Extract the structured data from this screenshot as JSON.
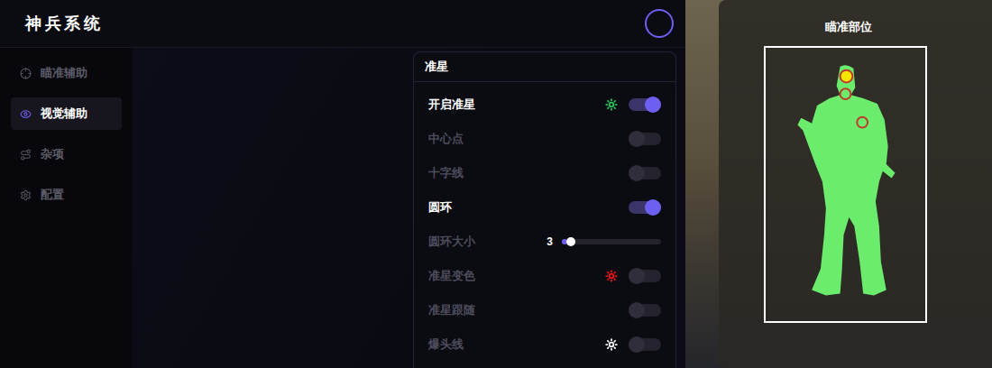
{
  "app": {
    "title": "神兵系统"
  },
  "sidebar": {
    "items": [
      {
        "label": "瞄准辅助",
        "selected": false
      },
      {
        "label": "视觉辅助",
        "selected": true
      },
      {
        "label": "杂项",
        "selected": false
      },
      {
        "label": "配置",
        "selected": false
      }
    ]
  },
  "panel": {
    "title": "准星",
    "rows": [
      {
        "kind": "toggle",
        "label": "开启准星",
        "on": true,
        "disabled": false,
        "color": "#22c55e"
      },
      {
        "kind": "toggle",
        "label": "中心点",
        "on": false,
        "disabled": true
      },
      {
        "kind": "toggle",
        "label": "十字线",
        "on": false,
        "disabled": true
      },
      {
        "kind": "toggle",
        "label": "圆环",
        "on": true,
        "disabled": false
      },
      {
        "kind": "slider",
        "label": "圆环大小",
        "value": "3",
        "level": 0.05,
        "disabled": true
      },
      {
        "kind": "toggle",
        "label": "准星变色",
        "on": false,
        "disabled": true,
        "color": "#ef1111"
      },
      {
        "kind": "toggle",
        "label": "准星跟随",
        "on": false,
        "disabled": true
      },
      {
        "kind": "toggle",
        "label": "爆头线",
        "on": false,
        "disabled": true,
        "color": "#ffffff"
      }
    ]
  },
  "aim": {
    "title": "瞄准部位",
    "hitboxes": [
      {
        "selected": true
      },
      {
        "selected": false
      },
      {
        "selected": false
      }
    ]
  }
}
